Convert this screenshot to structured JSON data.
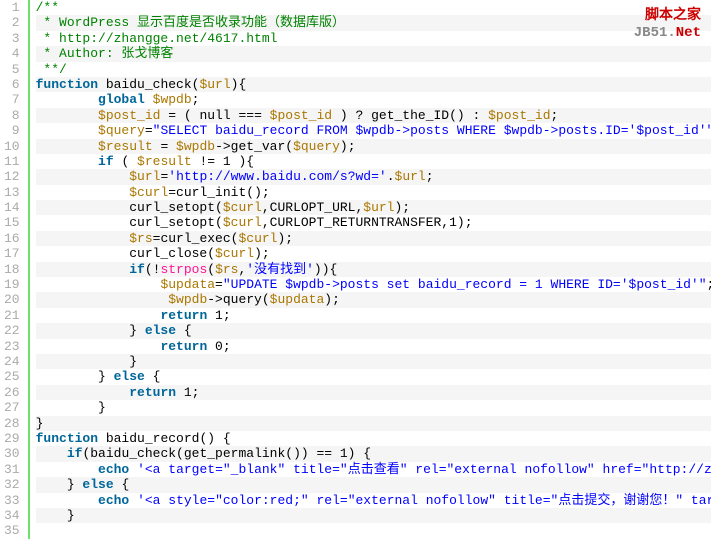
{
  "watermark": {
    "line1": "脚本之家",
    "line2_a": "JB51.",
    "line2_b": "Net"
  },
  "code": {
    "lines": [
      [
        {
          "t": "/**",
          "c": "c-comment"
        }
      ],
      [
        {
          "t": " * WordPress 显示百度是否收录功能（数据库版）",
          "c": "c-comment"
        }
      ],
      [
        {
          "t": " * http://zhangge.net/4617.html",
          "c": "c-comment"
        }
      ],
      [
        {
          "t": " * Author: 张戈博客",
          "c": "c-comment"
        }
      ],
      [
        {
          "t": " **/",
          "c": "c-comment"
        }
      ],
      [
        {
          "t": "function",
          "c": "c-keyword"
        },
        {
          "t": " baidu_check(",
          "c": "c-plain"
        },
        {
          "t": "$url",
          "c": "c-var"
        },
        {
          "t": "){",
          "c": "c-plain"
        }
      ],
      [
        {
          "t": "        ",
          "c": "c-plain"
        },
        {
          "t": "global",
          "c": "c-keyword"
        },
        {
          "t": " ",
          "c": "c-plain"
        },
        {
          "t": "$wpdb",
          "c": "c-var"
        },
        {
          "t": ";",
          "c": "c-plain"
        }
      ],
      [
        {
          "t": "        ",
          "c": "c-plain"
        },
        {
          "t": "$post_id",
          "c": "c-var"
        },
        {
          "t": " = ( null === ",
          "c": "c-plain"
        },
        {
          "t": "$post_id",
          "c": "c-var"
        },
        {
          "t": " ) ? get_the_ID() : ",
          "c": "c-plain"
        },
        {
          "t": "$post_id",
          "c": "c-var"
        },
        {
          "t": ";",
          "c": "c-plain"
        }
      ],
      [
        {
          "t": "        ",
          "c": "c-plain"
        },
        {
          "t": "$query",
          "c": "c-var"
        },
        {
          "t": "=",
          "c": "c-plain"
        },
        {
          "t": "\"SELECT baidu_record FROM $wpdb->posts WHERE $wpdb->posts.ID='$post_id'\"",
          "c": "c-string"
        },
        {
          "t": ";",
          "c": "c-plain"
        }
      ],
      [
        {
          "t": "        ",
          "c": "c-plain"
        },
        {
          "t": "$result",
          "c": "c-var"
        },
        {
          "t": " = ",
          "c": "c-plain"
        },
        {
          "t": "$wpdb",
          "c": "c-var"
        },
        {
          "t": "->get_var(",
          "c": "c-plain"
        },
        {
          "t": "$query",
          "c": "c-var"
        },
        {
          "t": ");",
          "c": "c-plain"
        }
      ],
      [
        {
          "t": "        ",
          "c": "c-plain"
        },
        {
          "t": "if",
          "c": "c-keyword"
        },
        {
          "t": " ( ",
          "c": "c-plain"
        },
        {
          "t": "$result",
          "c": "c-var"
        },
        {
          "t": " != 1 ){",
          "c": "c-plain"
        }
      ],
      [
        {
          "t": "            ",
          "c": "c-plain"
        },
        {
          "t": "$url",
          "c": "c-var"
        },
        {
          "t": "=",
          "c": "c-plain"
        },
        {
          "t": "'http://www.baidu.com/s?wd='",
          "c": "c-string"
        },
        {
          "t": ".",
          "c": "c-plain"
        },
        {
          "t": "$url",
          "c": "c-var"
        },
        {
          "t": ";",
          "c": "c-plain"
        }
      ],
      [
        {
          "t": "            ",
          "c": "c-plain"
        },
        {
          "t": "$curl",
          "c": "c-var"
        },
        {
          "t": "=curl_init();",
          "c": "c-plain"
        }
      ],
      [
        {
          "t": "            curl_setopt(",
          "c": "c-plain"
        },
        {
          "t": "$curl",
          "c": "c-var"
        },
        {
          "t": ",CURLOPT_URL,",
          "c": "c-plain"
        },
        {
          "t": "$url",
          "c": "c-var"
        },
        {
          "t": ");",
          "c": "c-plain"
        }
      ],
      [
        {
          "t": "            curl_setopt(",
          "c": "c-plain"
        },
        {
          "t": "$curl",
          "c": "c-var"
        },
        {
          "t": ",CURLOPT_RETURNTRANSFER,1);",
          "c": "c-plain"
        }
      ],
      [
        {
          "t": "            ",
          "c": "c-plain"
        },
        {
          "t": "$rs",
          "c": "c-var"
        },
        {
          "t": "=curl_exec(",
          "c": "c-plain"
        },
        {
          "t": "$curl",
          "c": "c-var"
        },
        {
          "t": ");",
          "c": "c-plain"
        }
      ],
      [
        {
          "t": "            curl_close(",
          "c": "c-plain"
        },
        {
          "t": "$curl",
          "c": "c-var"
        },
        {
          "t": ");",
          "c": "c-plain"
        }
      ],
      [
        {
          "t": "            ",
          "c": "c-plain"
        },
        {
          "t": "if",
          "c": "c-keyword"
        },
        {
          "t": "(!",
          "c": "c-plain"
        },
        {
          "t": "strpos",
          "c": "c-func"
        },
        {
          "t": "(",
          "c": "c-plain"
        },
        {
          "t": "$rs",
          "c": "c-var"
        },
        {
          "t": ",",
          "c": "c-plain"
        },
        {
          "t": "'没有找到'",
          "c": "c-string"
        },
        {
          "t": ")){",
          "c": "c-plain"
        }
      ],
      [
        {
          "t": "                ",
          "c": "c-plain"
        },
        {
          "t": "$updata",
          "c": "c-var"
        },
        {
          "t": "=",
          "c": "c-plain"
        },
        {
          "t": "\"UPDATE $wpdb->posts set baidu_record = 1 WHERE ID='$post_id'\"",
          "c": "c-string"
        },
        {
          "t": ";",
          "c": "c-plain"
        }
      ],
      [
        {
          "t": "                 ",
          "c": "c-plain"
        },
        {
          "t": "$wpdb",
          "c": "c-var"
        },
        {
          "t": "->query(",
          "c": "c-plain"
        },
        {
          "t": "$updata",
          "c": "c-var"
        },
        {
          "t": ");",
          "c": "c-plain"
        }
      ],
      [
        {
          "t": "                ",
          "c": "c-plain"
        },
        {
          "t": "return",
          "c": "c-keyword"
        },
        {
          "t": " 1;",
          "c": "c-plain"
        }
      ],
      [
        {
          "t": "            } ",
          "c": "c-plain"
        },
        {
          "t": "else",
          "c": "c-keyword"
        },
        {
          "t": " {",
          "c": "c-plain"
        }
      ],
      [
        {
          "t": "                ",
          "c": "c-plain"
        },
        {
          "t": "return",
          "c": "c-keyword"
        },
        {
          "t": " 0;",
          "c": "c-plain"
        }
      ],
      [
        {
          "t": "            }",
          "c": "c-plain"
        }
      ],
      [
        {
          "t": "        } ",
          "c": "c-plain"
        },
        {
          "t": "else",
          "c": "c-keyword"
        },
        {
          "t": " {",
          "c": "c-plain"
        }
      ],
      [
        {
          "t": "            ",
          "c": "c-plain"
        },
        {
          "t": "return",
          "c": "c-keyword"
        },
        {
          "t": " 1;",
          "c": "c-plain"
        }
      ],
      [
        {
          "t": "        }",
          "c": "c-plain"
        }
      ],
      [
        {
          "t": "}",
          "c": "c-plain"
        }
      ],
      [
        {
          "t": "function",
          "c": "c-keyword"
        },
        {
          "t": " baidu_record() {",
          "c": "c-plain"
        }
      ],
      [
        {
          "t": "    ",
          "c": "c-plain"
        },
        {
          "t": "if",
          "c": "c-keyword"
        },
        {
          "t": "(baidu_check(get_permalink()) == 1) {",
          "c": "c-plain"
        }
      ],
      [
        {
          "t": "        ",
          "c": "c-plain"
        },
        {
          "t": "echo",
          "c": "c-keyword"
        },
        {
          "t": " ",
          "c": "c-plain"
        },
        {
          "t": "'<a target=\"_blank\" title=\"点击查看\" rel=\"external nofollow\" href=\"http://zhangge.",
          "c": "c-string"
        }
      ],
      [
        {
          "t": "    } ",
          "c": "c-plain"
        },
        {
          "t": "else",
          "c": "c-keyword"
        },
        {
          "t": " {",
          "c": "c-plain"
        }
      ],
      [
        {
          "t": "        ",
          "c": "c-plain"
        },
        {
          "t": "echo",
          "c": "c-keyword"
        },
        {
          "t": " ",
          "c": "c-plain"
        },
        {
          "t": "'<a style=\"color:red;\" rel=\"external nofollow\" title=\"点击提交，谢谢您！\" target=\"_b",
          "c": "c-string"
        }
      ],
      [
        {
          "t": "    }",
          "c": "c-plain"
        }
      ],
      [
        {
          "t": "",
          "c": "c-plain"
        }
      ]
    ]
  }
}
